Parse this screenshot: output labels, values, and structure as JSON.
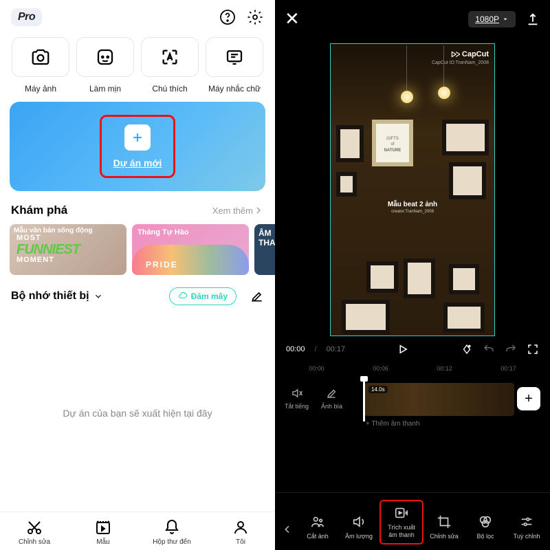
{
  "left": {
    "pro_badge": "Pro",
    "tools": {
      "camera": "Máy ảnh",
      "smooth": "Làm mịn",
      "caption": "Chú thích",
      "teleprompter": "Máy nhắc chữ"
    },
    "new_project": "Dự án mới",
    "explore": {
      "title": "Khám phá",
      "more": "Xem thêm",
      "card1_l1": "MOST",
      "card1_l2": "FUNNIEST",
      "card1_l3": "MOMENT",
      "card1_title": "Mẫu văn bản sống động",
      "card2_title": "Tháng Tự Hào",
      "card3_title": "ÂM THANH"
    },
    "device": {
      "title": "Bộ nhớ thiết bị",
      "cloud": "Đám mây"
    },
    "empty_msg": "Dự án của bạn sẽ xuất hiện tại đây",
    "nav": {
      "edit": "Chỉnh sửa",
      "template": "Mẫu",
      "inbox": "Hộp thư đến",
      "me": "Tôi"
    }
  },
  "right": {
    "resolution": "1080P",
    "capcut": "CapCut",
    "capcut_id": "CapCut ID:TranNam_2008",
    "frame_nature_l1": "GIFTS",
    "frame_nature_l2": "NATURE",
    "overlay_title": "Mẫu beat 2 ảnh",
    "overlay_creator": "creator:TranNam_2008",
    "time_current": "00:00",
    "time_total": "00:17",
    "ruler": {
      "t0": "00:00",
      "t1": "00:06",
      "t2": "00:12",
      "t3": "00:17"
    },
    "timeline": {
      "mute": "Tắt tiếng",
      "cover": "Ảnh bìa",
      "clip_dur": "14.0s",
      "add_audio": "+ Thêm âm thanh"
    },
    "toolbar": {
      "crop": "Cắt ảnh",
      "volume": "Âm lượng",
      "extract_audio_l1": "Trích xuất",
      "extract_audio_l2": "âm thanh",
      "edit": "Chỉnh sửa",
      "filter": "Bộ lọc",
      "adjust": "Tuỳ chỉnh"
    }
  }
}
